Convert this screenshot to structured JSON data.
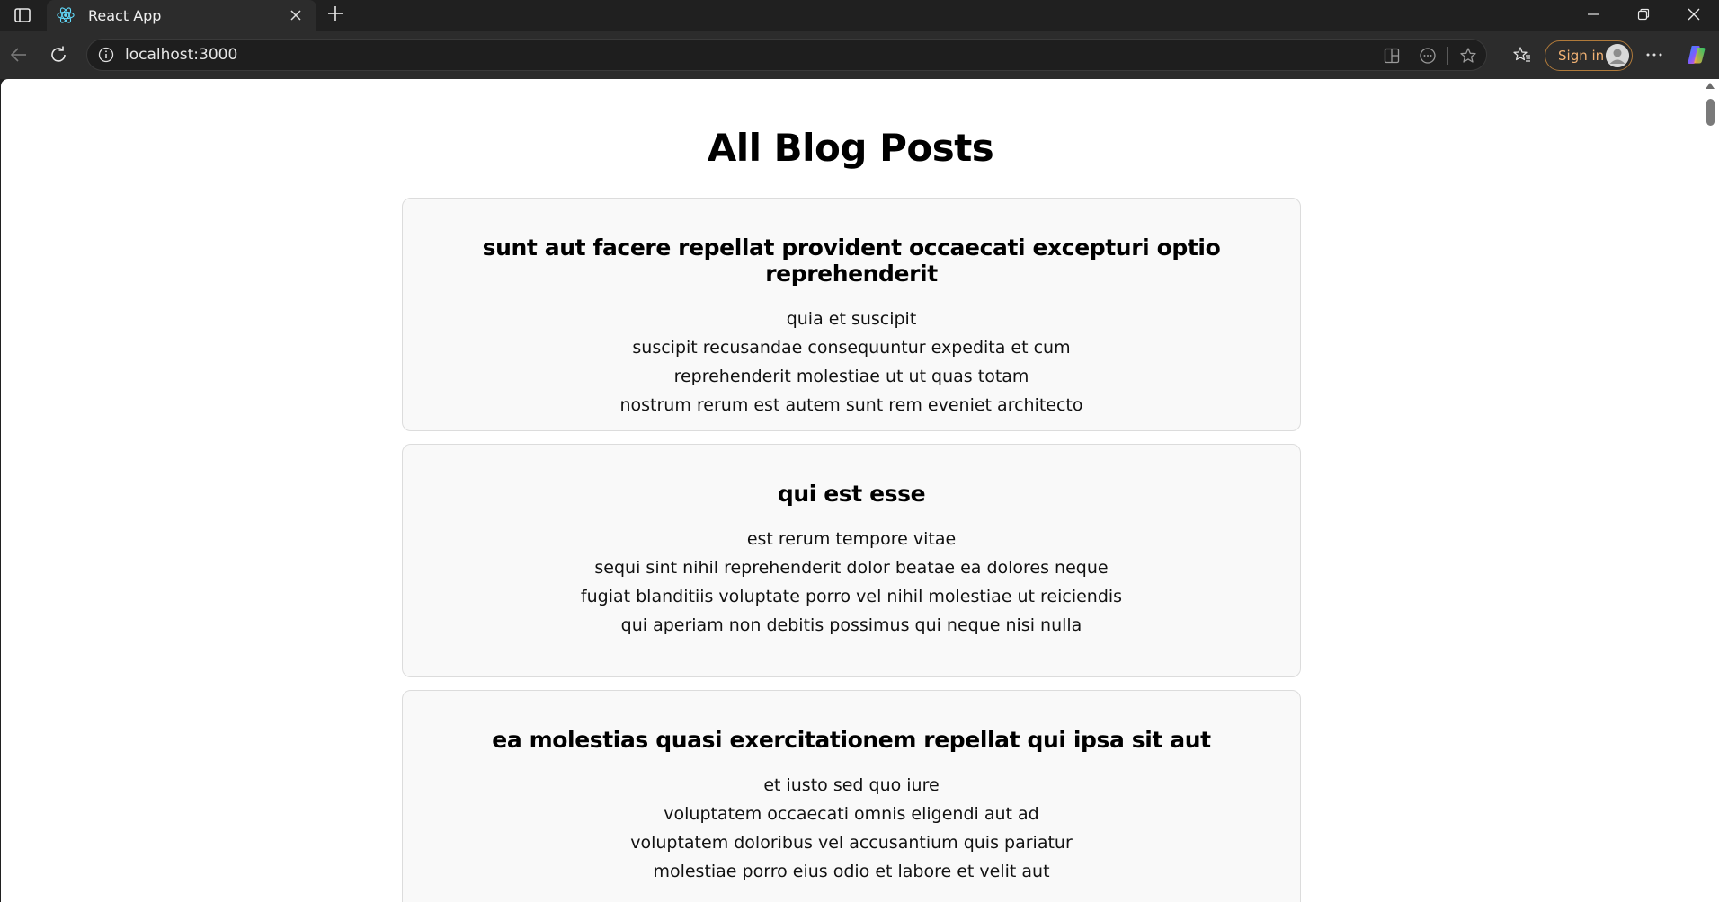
{
  "browser": {
    "tab": {
      "title": "React App"
    },
    "address": {
      "url": "localhost:3000"
    },
    "signin_label": "Sign in"
  },
  "page": {
    "heading": "All Blog Posts",
    "posts": [
      {
        "title": "sunt aut facere repellat provident occaecati excepturi optio reprehenderit",
        "body": "quia et suscipit\nsuscipit recusandae consequuntur expedita et cum\nreprehenderit molestiae ut ut quas totam\nnostrum rerum est autem sunt rem eveniet architecto"
      },
      {
        "title": "qui est esse",
        "body": "est rerum tempore vitae\nsequi sint nihil reprehenderit dolor beatae ea dolores neque\nfugiat blanditiis voluptate porro vel nihil molestiae ut reiciendis\nqui aperiam non debitis possimus qui neque nisi nulla"
      },
      {
        "title": "ea molestias quasi exercitationem repellat qui ipsa sit aut",
        "body": "et iusto sed quo iure\nvoluptatem occaecati omnis eligendi aut ad\nvoluptatem doloribus vel accusantium quis pariatur\nmolestiae porro eius odio et labore et velit aut"
      }
    ]
  },
  "colors": {
    "chrome_bg": "#202020",
    "toolbar_bg": "#2c2c2c",
    "card_bg": "#f9f9f9",
    "card_border": "#dcdcdc",
    "signin_accent": "#f2b274"
  },
  "icons": {
    "tab_actions": "tab-actions-icon",
    "favicon": "react-logo-icon",
    "back": "back-arrow-icon",
    "refresh": "refresh-icon",
    "info": "info-icon",
    "split_screen": "split-screen-icon",
    "more_tools": "more-tools-icon",
    "favorite": "star-icon",
    "favorites": "favorites-icon",
    "menu": "ellipsis-icon",
    "copilot": "copilot-icon"
  }
}
